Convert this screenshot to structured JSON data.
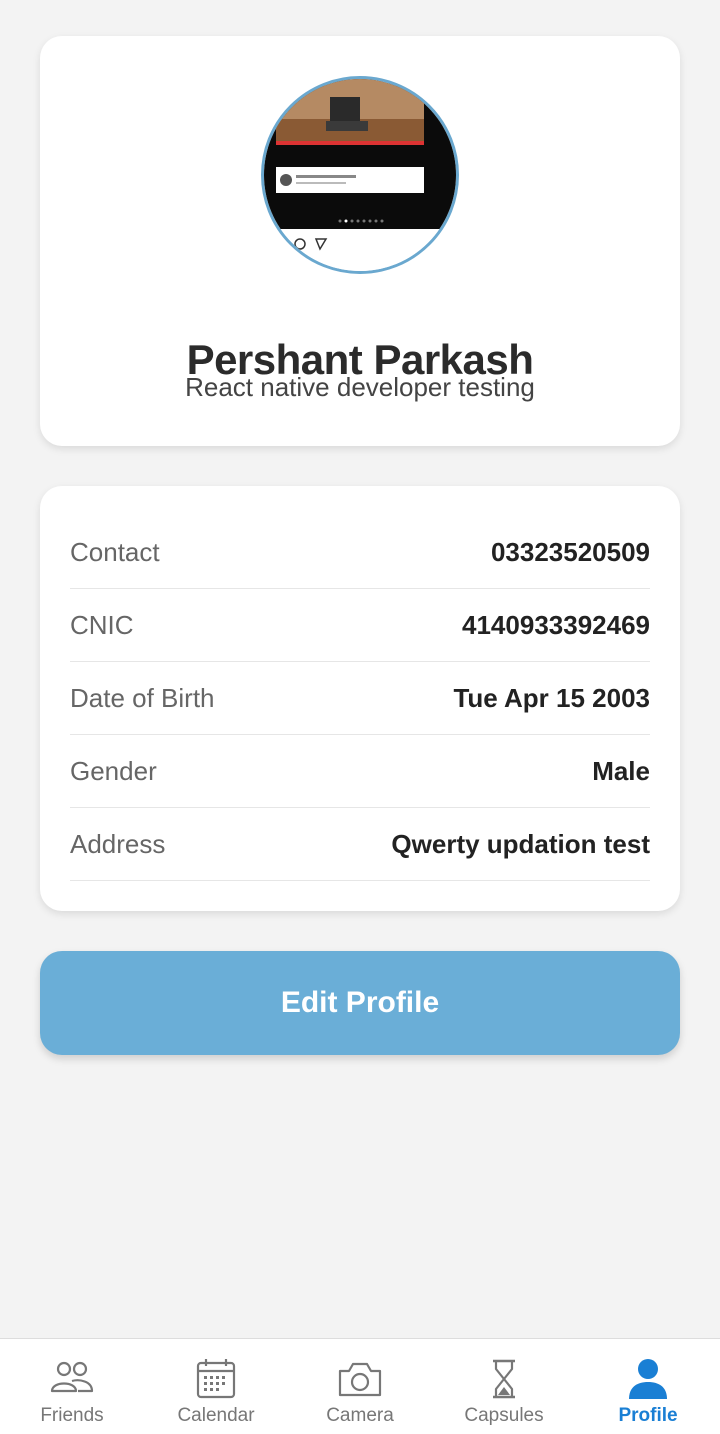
{
  "profile": {
    "name": "Pershant Parkash",
    "bio": "React native developer testing"
  },
  "details": [
    {
      "label": "Contact",
      "value": "03323520509"
    },
    {
      "label": "CNIC",
      "value": "4140933392469"
    },
    {
      "label": "Date of Birth",
      "value": "Tue Apr 15 2003"
    },
    {
      "label": "Gender",
      "value": "Male"
    },
    {
      "label": "Address",
      "value": "Qwerty updation test"
    }
  ],
  "edit_button": {
    "label": "Edit Profile"
  },
  "tabs": [
    {
      "label": "Friends",
      "icon": "friends-icon"
    },
    {
      "label": "Calendar",
      "icon": "calendar-icon"
    },
    {
      "label": "Camera",
      "icon": "camera-icon"
    },
    {
      "label": "Capsules",
      "icon": "hourglass-icon"
    },
    {
      "label": "Profile",
      "icon": "person-icon",
      "active": true
    }
  ],
  "colors": {
    "accent": "#1a7fd4",
    "button": "#6aaed7",
    "avatar_border": "#6aa8cf"
  }
}
